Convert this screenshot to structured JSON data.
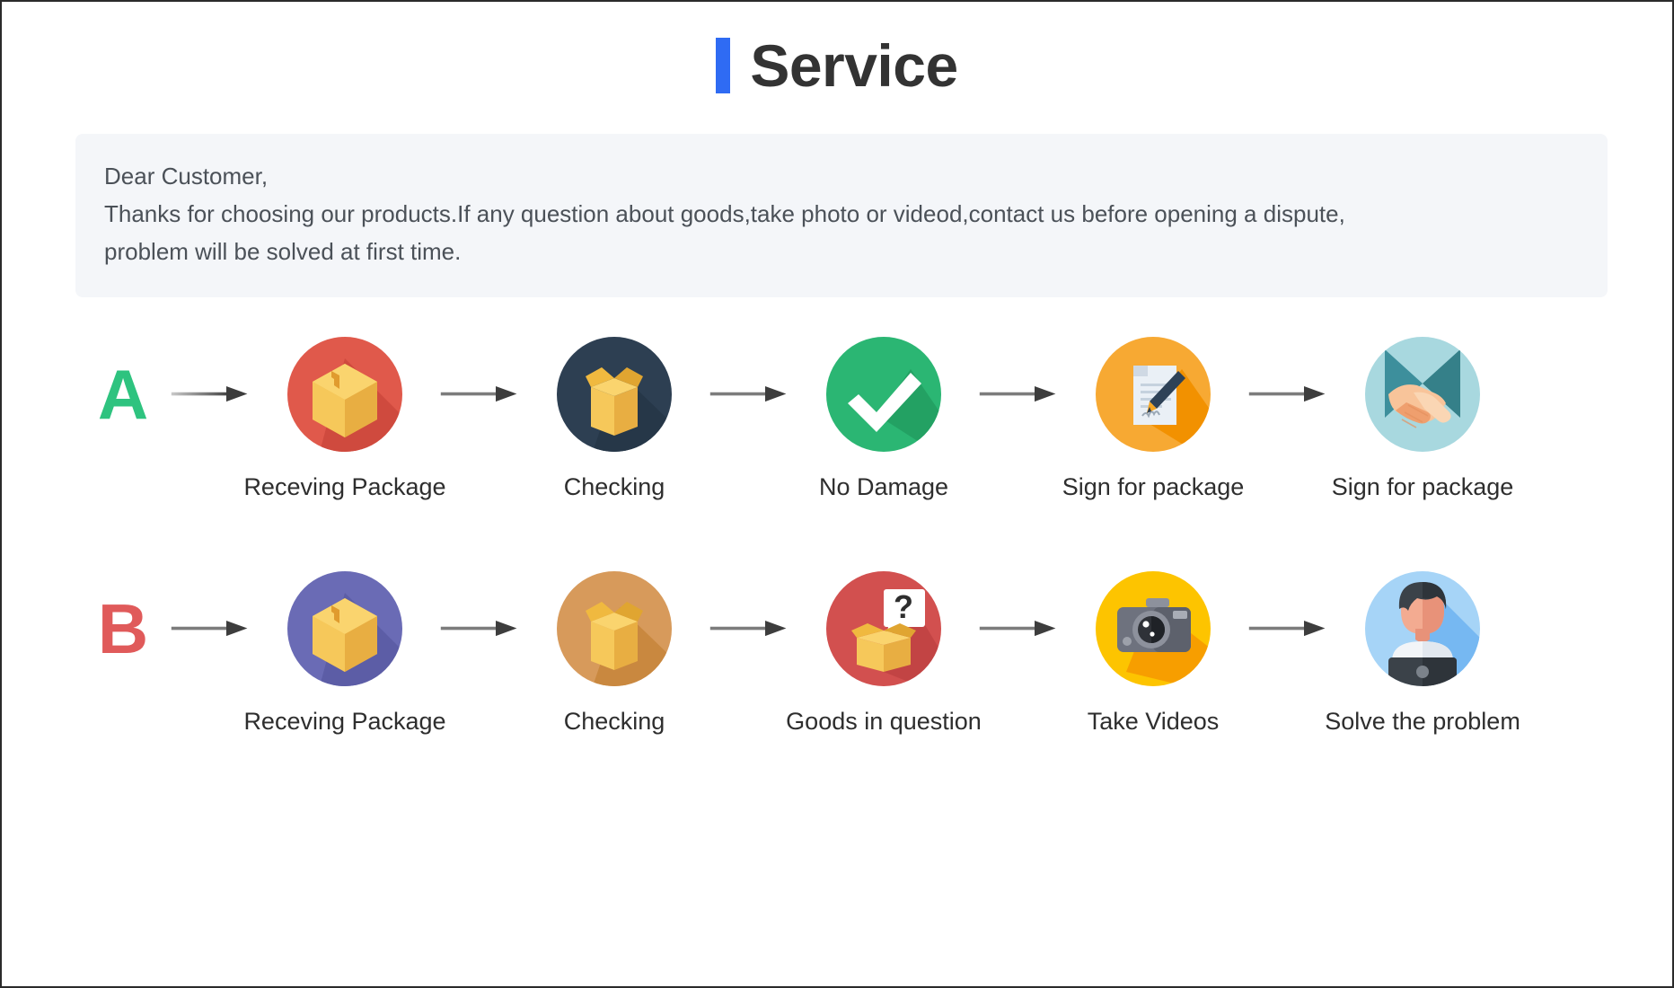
{
  "header": {
    "title": "Service",
    "accent_color": "#2f6bf3"
  },
  "note": {
    "background": "#f4f6f9",
    "lines": [
      "Dear Customer,",
      "Thanks for choosing our products.If any question about goods,take photo or videod,contact us before opening a dispute,",
      "problem will be solved at first time."
    ]
  },
  "flows": [
    {
      "letter": "A",
      "letter_color": "#2ec37f",
      "steps": [
        {
          "label": "Receving Package",
          "icon": "package-box-icon",
          "circle_color": "#e0594b"
        },
        {
          "label": "Checking",
          "icon": "open-box-icon",
          "circle_color": "#2d3f52"
        },
        {
          "label": "No Damage",
          "icon": "check-mark-icon",
          "circle_color": "#2bb673"
        },
        {
          "label": "Sign for package",
          "icon": "sign-document-icon",
          "circle_color": "#f7a933"
        },
        {
          "label": "Sign for package",
          "icon": "handshake-icon",
          "circle_color": "#a8d8df"
        }
      ]
    },
    {
      "letter": "B",
      "letter_color": "#e05a5a",
      "steps": [
        {
          "label": "Receving Package",
          "icon": "package-box-icon",
          "circle_color": "#6a6bb5"
        },
        {
          "label": "Checking",
          "icon": "open-box-icon",
          "circle_color": "#d79a5b"
        },
        {
          "label": "Goods in question",
          "icon": "question-box-icon",
          "circle_color": "#d2504f"
        },
        {
          "label": "Take Videos",
          "icon": "camera-icon",
          "circle_color": "#fdc400"
        },
        {
          "label": "Solve the problem",
          "icon": "support-agent-icon",
          "circle_color": "#a6d4f7"
        }
      ]
    }
  ],
  "arrow": {
    "icon": "arrow-right-icon",
    "color": "#4d4d4d"
  }
}
